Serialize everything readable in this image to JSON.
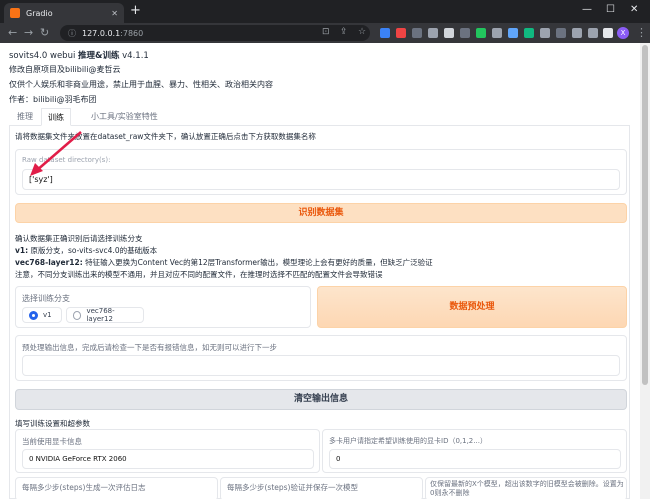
{
  "browser": {
    "tab_title": "Gradio",
    "url_host": "127.0.0.1",
    "url_port": ":7860"
  },
  "header": {
    "title_prefix": "sovits4.0 webui ",
    "title_bold": "推理&训练",
    "title_suffix": " v4.1.1",
    "line1": "修改自原项目及bilibili@麦哲云",
    "line2": "仅供个人娱乐和非商业用途，禁止用于血腥、暴力、性相关、政治相关内容",
    "line3": "作者：bilibili@羽毛布团"
  },
  "tabs": [
    "推理",
    "训练",
    "小工具/实验室特性"
  ],
  "train": {
    "instruction": "请将数据集文件夹放置在dataset_raw文件夹下，确认放置正确后点击下方获取数据集名称",
    "raw_dir_label": "Raw dataset directory(s):",
    "raw_dir_value": "['syz']",
    "identify_button": "识别数据集",
    "desc_line1": "确认数据集正确识别后请选择训练分支",
    "desc_line2_bold": "v1:",
    "desc_line2": " 原版分支，so-vits-svc4.0的基础版本",
    "desc_line3_bold": "vec768-layer12:",
    "desc_line3": " 特征输入更换为Content Vec的第12层Transformer输出，模型理论上会有更好的质量，但缺乏广泛验证",
    "desc_line4": "注意，不同分支训练出来的模型不通用，并且对应不同的配置文件，在推理时选择不匹配的配置文件会导致错误",
    "branch_label": "选择训练分支",
    "branch_options": [
      "v1",
      "vec768-layer12"
    ],
    "branch_selected": "v1",
    "preprocess_button": "数据预处理",
    "output_label": "预处理输出信息，完成后请检查一下是否有报错信息，如无则可以进行下一步",
    "output_value": "",
    "clear_button": "清空输出信息",
    "settings_header": "填写训练设置和超参数",
    "gpu_label": "当前使用显卡信息",
    "gpu_value": "0 NVIDIA GeForce RTX 2060",
    "gpu_select_label": "多卡用户请指定希望训练使用的显卡ID（0,1,2...）",
    "gpu_select_value": "0",
    "eval_label": "每隔多少步(steps)生成一次评估日志",
    "save_label": "每隔多少步(steps)验证并保存一次模型",
    "keep_label": "仅保留最新的X个模型，超出该数字的旧模型会被删除。设置为0则永不删除"
  },
  "colors": {
    "accent_orange": "#ea580c",
    "arrow_red": "#e11d48",
    "radio_blue": "#2563eb"
  }
}
